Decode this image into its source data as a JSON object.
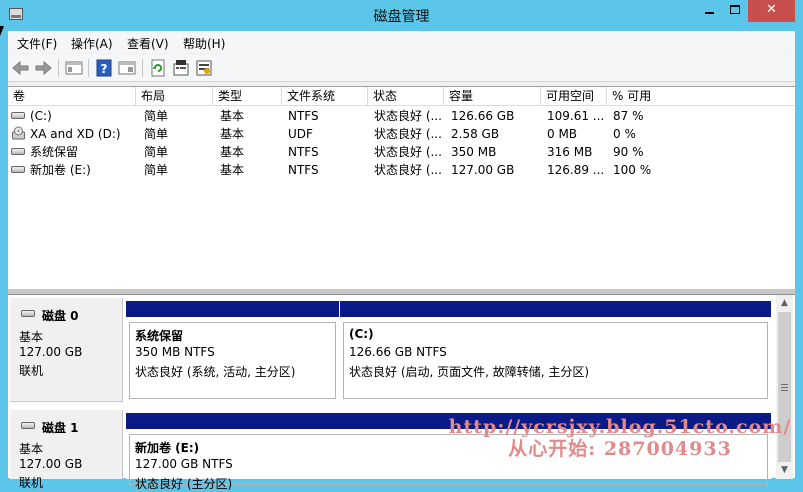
{
  "window": {
    "title": "磁盘管理",
    "min_icon": "minimize-icon",
    "max_icon": "maximize-icon",
    "close_icon": "close-icon",
    "close_label": "✕",
    "title_bar_color": "#5bc6ea",
    "close_color": "#c7504f"
  },
  "menu": {
    "items": [
      "文件(F)",
      "操作(A)",
      "查看(V)",
      "帮助(H)"
    ]
  },
  "toolbar": {
    "icons": [
      "back-icon",
      "forward-icon",
      "console-tree-icon",
      "help-icon",
      "details-icon",
      "refresh-icon",
      "properties-icon",
      "rescan-icon"
    ]
  },
  "volume_list": {
    "columns": [
      "卷",
      "布局",
      "类型",
      "文件系统",
      "状态",
      "容量",
      "可用空间",
      "% 可用"
    ],
    "rows": [
      {
        "icon": "drive-icon",
        "volume": "(C:)",
        "layout": "简单",
        "type": "基本",
        "fs": "NTFS",
        "status": "状态良好 (...",
        "capacity": "126.66 GB",
        "free": "109.61 ...",
        "pct": "87 %"
      },
      {
        "icon": "cd-drive-icon",
        "volume": "XA and XD  (D:)",
        "layout": "简单",
        "type": "基本",
        "fs": "UDF",
        "status": "状态良好 (...",
        "capacity": "2.58 GB",
        "free": "0 MB",
        "pct": "0 %"
      },
      {
        "icon": "drive-icon",
        "volume": "系统保留",
        "layout": "简单",
        "type": "基本",
        "fs": "NTFS",
        "status": "状态良好 (...",
        "capacity": "350 MB",
        "free": "316 MB",
        "pct": "90 %"
      },
      {
        "icon": "drive-icon",
        "volume": "新加卷 (E:)",
        "layout": "简单",
        "type": "基本",
        "fs": "NTFS",
        "status": "状态良好 (...",
        "capacity": "127.00 GB",
        "free": "126.89 ...",
        "pct": "100 %"
      }
    ]
  },
  "disks": [
    {
      "name": "磁盘 0",
      "type": "基本",
      "size": "127.00 GB",
      "state": "联机",
      "partitions": [
        {
          "name": "系统保留",
          "size": "350 MB NTFS",
          "status": "状态良好 (系统, 活动, 主分区)"
        },
        {
          "name": "(C:)",
          "size": "126.66 GB NTFS",
          "status": "状态良好 (启动, 页面文件, 故障转储, 主分区)"
        }
      ]
    },
    {
      "name": "磁盘 1",
      "type": "基本",
      "size": "127.00 GB",
      "state": "联机",
      "partitions": [
        {
          "name": "新加卷  (E:)",
          "size": "127.00 GB NTFS",
          "status": "状态良好 (主分区)"
        }
      ]
    }
  ],
  "partition_bar_color": "#0a1a86",
  "watermark": {
    "line1": "http://ycrsjxy.blog.51cto.com/",
    "line2": "从心开始: 287004933"
  }
}
